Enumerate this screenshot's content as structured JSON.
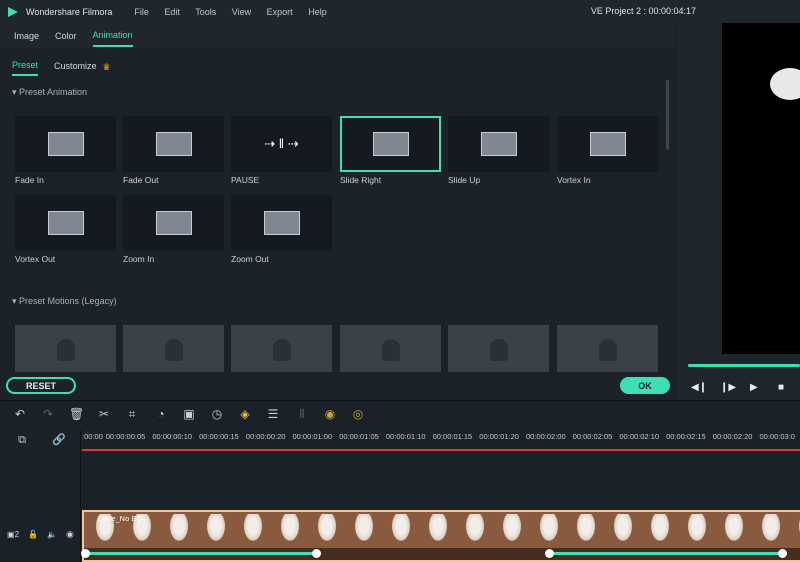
{
  "app": {
    "title": "Wondershare Filmora",
    "menu": [
      "File",
      "Edit",
      "Tools",
      "View",
      "Export",
      "Help"
    ],
    "project": "VE Project 2 : 00:00:04:17",
    "accent": "#3de0b5"
  },
  "tabs": [
    "Image",
    "Color",
    "Animation"
  ],
  "active_tab": "Animation",
  "subtabs": {
    "preset": "Preset",
    "customize": "Customize"
  },
  "sections": {
    "preset_animation": "Preset Animation",
    "preset_motions": "Preset Motions (Legacy)"
  },
  "presets": [
    "Fade In",
    "Fade Out",
    "PAUSE",
    "Slide Right",
    "Slide Up",
    "Vortex In",
    "Vortex Out",
    "Zoom In",
    "Zoom Out"
  ],
  "selected_preset": "Slide Right",
  "buttons": {
    "reset": "RESET",
    "ok": "OK"
  },
  "ruler": [
    ":00:00",
    "00:00:00:05",
    "00:00:00:10",
    "00:00:00:15",
    "00:00:00:20",
    "00:00:01:00",
    "00:00:01:05",
    "00:00:01:10",
    "00:00:01:15",
    "00:00:01:20",
    "00:00:02:00",
    "00:00:02:05",
    "00:00:02:10",
    "00:00:02:15",
    "00:00:02:20",
    "00:00:03:0"
  ],
  "track": {
    "number": "2",
    "clip_name": "Dove_No BG"
  }
}
